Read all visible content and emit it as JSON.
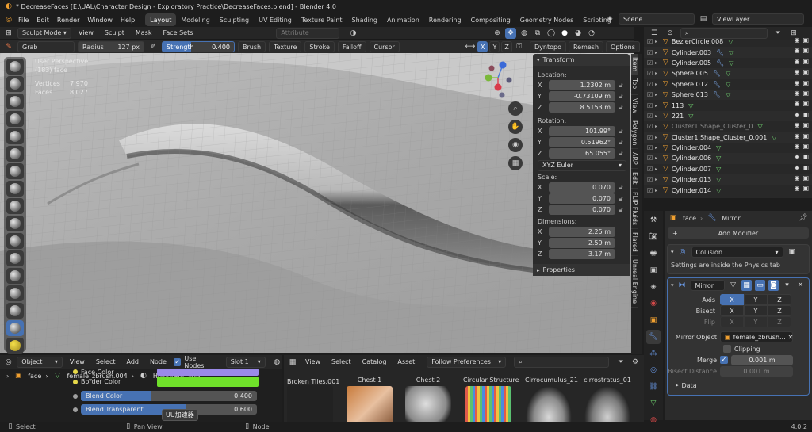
{
  "window": {
    "title": "* DecreaseFaces [E:\\UAL\\Character Design - Exploratory Practice\\DecreaseFaces.blend] - Blender 4.0"
  },
  "menu": [
    "File",
    "Edit",
    "Render",
    "Window",
    "Help"
  ],
  "workspaces": [
    "Layout",
    "Modeling",
    "Sculpting",
    "UV Editing",
    "Texture Paint",
    "Shading",
    "Animation",
    "Rendering",
    "Compositing",
    "Geometry Nodes",
    "Scripting"
  ],
  "scene": {
    "name": "Scene",
    "view_layer": "ViewLayer"
  },
  "viewport_header": {
    "mode": "Sculpt Mode",
    "items": [
      "View",
      "Sculpt",
      "Mask",
      "Face Sets"
    ],
    "attribute_placeholder": "Attribute"
  },
  "tool_header": {
    "brush": "Grab",
    "radius_label": "Radius",
    "radius_value": "127 px",
    "strength_label": "Strength",
    "strength_value": "0.400",
    "menus": [
      "Brush",
      "Texture",
      "Stroke",
      "Falloff",
      "Cursor"
    ],
    "axes": [
      "X",
      "Y",
      "Z"
    ],
    "right": [
      "Dyntopo",
      "Remesh",
      "Options"
    ]
  },
  "stats": {
    "view": "User Perspective",
    "object": "(183) face",
    "vertices_label": "Vertices",
    "vertices": "7,970",
    "faces_label": "Faces",
    "faces": "8,027"
  },
  "transform": {
    "title": "Transform",
    "location_label": "Location:",
    "location": [
      {
        "axis": "X",
        "value": "1.2302 m"
      },
      {
        "axis": "Y",
        "value": "-0.73109 m"
      },
      {
        "axis": "Z",
        "value": "8.5153 m"
      }
    ],
    "rotation_label": "Rotation:",
    "rotation": [
      {
        "axis": "X",
        "value": "101.99°"
      },
      {
        "axis": "Y",
        "value": "0.51962°"
      },
      {
        "axis": "Z",
        "value": "65.055°"
      }
    ],
    "rotation_mode": "XYZ Euler",
    "scale_label": "Scale:",
    "scale": [
      {
        "axis": "X",
        "value": "0.070"
      },
      {
        "axis": "Y",
        "value": "0.070"
      },
      {
        "axis": "Z",
        "value": "0.070"
      }
    ],
    "dimensions_label": "Dimensions:",
    "dimensions": [
      {
        "axis": "X",
        "value": "2.25 m"
      },
      {
        "axis": "Y",
        "value": "2.59 m"
      },
      {
        "axis": "Z",
        "value": "3.17 m"
      }
    ],
    "properties_label": "Properties"
  },
  "side_tabs": [
    "Item",
    "Tool",
    "View",
    "Polygon",
    "ARP",
    "Edit",
    "FLIP Fluids",
    "Flared",
    "Unreal Engine"
  ],
  "outliner": {
    "items": [
      {
        "name": "BezierCircle.008",
        "type": "mesh"
      },
      {
        "name": "Cylinder.003",
        "type": "mesh",
        "mod": true
      },
      {
        "name": "Cylinder.005",
        "type": "mesh",
        "mod": true
      },
      {
        "name": "Sphere.005",
        "type": "mesh",
        "mod": true
      },
      {
        "name": "Sphere.012",
        "type": "mesh",
        "mod": true
      },
      {
        "name": "Sphere.013",
        "type": "mesh",
        "mod": true
      },
      {
        "name": "113",
        "type": "mesh"
      },
      {
        "name": "221",
        "type": "mesh"
      },
      {
        "name": "Cluster1.Shape_Cluster_0",
        "type": "mesh",
        "dim": true
      },
      {
        "name": "Cluster1.Shape_Cluster_0.001",
        "type": "mesh"
      },
      {
        "name": "Cylinder.004",
        "type": "mesh"
      },
      {
        "name": "Cylinder.006",
        "type": "mesh"
      },
      {
        "name": "Cylinder.007",
        "type": "mesh"
      },
      {
        "name": "Cylinder.013",
        "type": "mesh"
      },
      {
        "name": "Cylinder.014",
        "type": "mesh"
      }
    ]
  },
  "properties": {
    "object_name": "face",
    "modifier_context": "Mirror",
    "add_modifier": "Add Modifier",
    "collision": {
      "name": "Collision",
      "note": "Settings are inside the Physics tab"
    },
    "mirror": {
      "name": "Mirror",
      "axis_label": "Axis",
      "bisect_label": "Bisect",
      "flip_label": "Flip",
      "axes": [
        "X",
        "Y",
        "Z"
      ],
      "mirror_object_label": "Mirror Object",
      "mirror_object": "female_zbrush...",
      "clipping_label": "Clipping",
      "merge_label": "Merge",
      "merge_value": "0.001 m",
      "bisect_distance_label": "Bisect Distance",
      "bisect_distance_value": "0.001 m",
      "data_label": "Data"
    }
  },
  "node_editor": {
    "type": "Object",
    "menus": [
      "View",
      "Select",
      "Add",
      "Node"
    ],
    "use_nodes": "Use Nodes",
    "slot": "Slot 1",
    "breadcrumb": [
      "face",
      "female_zbrush.004",
      "Hologram_SUB"
    ],
    "face_color": "Face Color",
    "border_color": "Border Color",
    "blend_color_label": "Blend Color",
    "blend_color_value": "0.400",
    "blend_transparent_label": "Blend Transparent",
    "blend_transparent_value": "0.600",
    "tooltip": "UU加速器"
  },
  "asset_browser": {
    "menus": [
      "View",
      "Select",
      "Catalog",
      "Asset"
    ],
    "import": "Follow Preferences",
    "assets": [
      "Broken Tiles.001",
      "Chest 1",
      "Chest 2",
      "Circular Structure",
      "Cirrocumulus_21",
      "cirrostratus_01"
    ]
  },
  "status_bar": {
    "left": "Select",
    "middle": "Pan View",
    "right": "Node",
    "version": "4.0.2"
  },
  "colors": {
    "accent": "#4772b3",
    "green": "#6fd16f",
    "orange": "#f0a030"
  }
}
